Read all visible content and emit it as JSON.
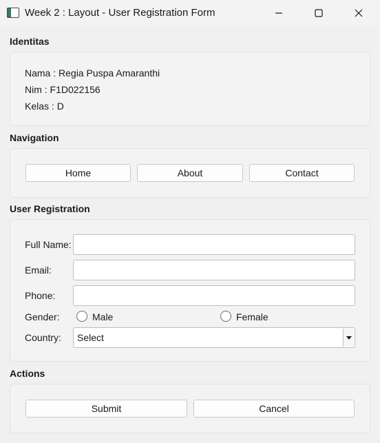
{
  "window": {
    "title": "Week 2 : Layout - User Registration Form"
  },
  "identitas": {
    "title": "Identitas",
    "nama": "Nama : Regia Puspa Amaranthi",
    "nim": "Nim : F1D022156",
    "kelas": "Kelas : D"
  },
  "navigation": {
    "title": "Navigation",
    "buttons": [
      "Home",
      "About",
      "Contact"
    ]
  },
  "registration": {
    "title": "User Registration",
    "full_name_label": "Full Name:",
    "full_name_value": "",
    "email_label": "Email:",
    "email_value": "",
    "phone_label": "Phone:",
    "phone_value": "",
    "gender_label": "Gender:",
    "gender_options": [
      "Male",
      "Female"
    ],
    "country_label": "Country:",
    "country_selected": "Select"
  },
  "actions": {
    "title": "Actions",
    "submit_label": "Submit",
    "cancel_label": "Cancel"
  },
  "icons": {
    "app": "app-window-icon",
    "minimize": "minimize-icon",
    "maximize": "maximize-icon",
    "close": "close-icon",
    "dropdown": "chevron-down-icon"
  }
}
